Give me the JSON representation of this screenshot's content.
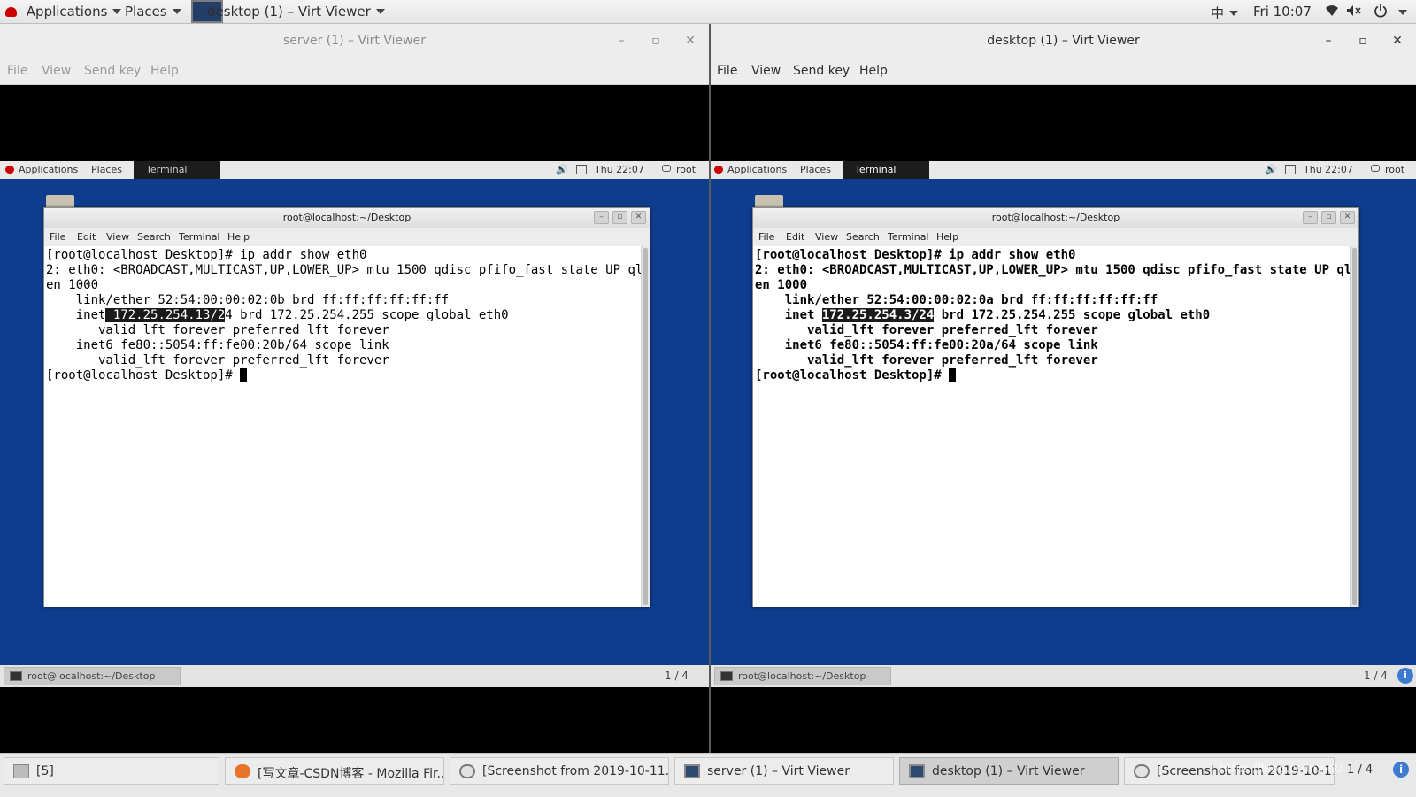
{
  "host_panel": {
    "applications": "Applications",
    "places": "Places",
    "active_window": "desktop (1) – Virt Viewer",
    "input_method": "中",
    "clock": "Fri 10:07"
  },
  "windows": [
    {
      "title": "server (1) – Virt Viewer",
      "focused": false,
      "menu": [
        "File",
        "View",
        "Send key",
        "Help"
      ],
      "guest": {
        "panel": {
          "applications": "Applications",
          "places": "Places",
          "terminal": "Terminal",
          "clock": "Thu 22:07",
          "user": "root"
        },
        "terminal": {
          "title": "root@localhost:~/Desktop",
          "menu": [
            "File",
            "Edit",
            "View",
            "Search",
            "Terminal",
            "Help"
          ],
          "lines": [
            "[root@localhost Desktop]# ip addr show eth0",
            "2: eth0: <BROADCAST,MULTICAST,UP,LOWER_UP> mtu 1500 qdisc pfifo_fast state UP ql",
            "en 1000",
            "    link/ether 52:54:00:00:02:0b brd ff:ff:ff:ff:ff:ff"
          ],
          "inet_prefix": "    inet",
          "inet_selected": " 172.25.254.13/2",
          "inet_suffix": "4 brd 172.25.254.255 scope global eth0",
          "lines_after": [
            "       valid_lft forever preferred_lft forever",
            "    inet6 fe80::5054:ff:fe00:20b/64 scope link",
            "       valid_lft forever preferred_lft forever"
          ],
          "prompt": "[root@localhost Desktop]# "
        },
        "taskbar_item": "root@localhost:~/Desktop",
        "workspace": "1 / 4"
      }
    },
    {
      "title": "desktop (1) – Virt Viewer",
      "focused": true,
      "menu": [
        "File",
        "View",
        "Send key",
        "Help"
      ],
      "guest": {
        "panel": {
          "applications": "Applications",
          "places": "Places",
          "terminal": "Terminal",
          "clock": "Thu 22:07",
          "user": "root"
        },
        "terminal": {
          "title": "root@localhost:~/Desktop",
          "menu": [
            "File",
            "Edit",
            "View",
            "Search",
            "Terminal",
            "Help"
          ],
          "lines": [
            "[root@localhost Desktop]# ip addr show eth0",
            "2: eth0: <BROADCAST,MULTICAST,UP,LOWER_UP> mtu 1500 qdisc pfifo_fast state UP ql",
            "en 1000",
            "    link/ether 52:54:00:00:02:0a brd ff:ff:ff:ff:ff:ff"
          ],
          "inet_prefix": "    inet ",
          "inet_selected": "172.25.254.3/24",
          "inet_suffix": " brd 172.25.254.255 scope global eth0",
          "lines_after": [
            "       valid_lft forever preferred_lft forever",
            "    inet6 fe80::5054:ff:fe00:20a/64 scope link",
            "       valid_lft forever preferred_lft forever"
          ],
          "prompt": "[root@localhost Desktop]# "
        },
        "taskbar_item": "root@localhost:~/Desktop",
        "workspace": "1 / 4"
      }
    }
  ],
  "host_taskbar": {
    "items": [
      {
        "label": "[5]",
        "icon": "window-list-icon",
        "active": false
      },
      {
        "label": "[写文章-CSDN博客 - Mozilla Fir...",
        "icon": "firefox-icon",
        "active": false
      },
      {
        "label": "[Screenshot from 2019-10-11...",
        "icon": "screenshot-icon",
        "active": false
      },
      {
        "label": "server (1) – Virt Viewer",
        "icon": "virt-viewer-icon",
        "active": false
      },
      {
        "label": "desktop (1) – Virt Viewer",
        "icon": "virt-viewer-icon",
        "active": true
      },
      {
        "label": "[Screenshot from 2019-10-11...",
        "icon": "screenshot-icon",
        "active": false
      }
    ],
    "workspace": "1 / 4",
    "watermark": "https://blog.csdn.net/..."
  }
}
